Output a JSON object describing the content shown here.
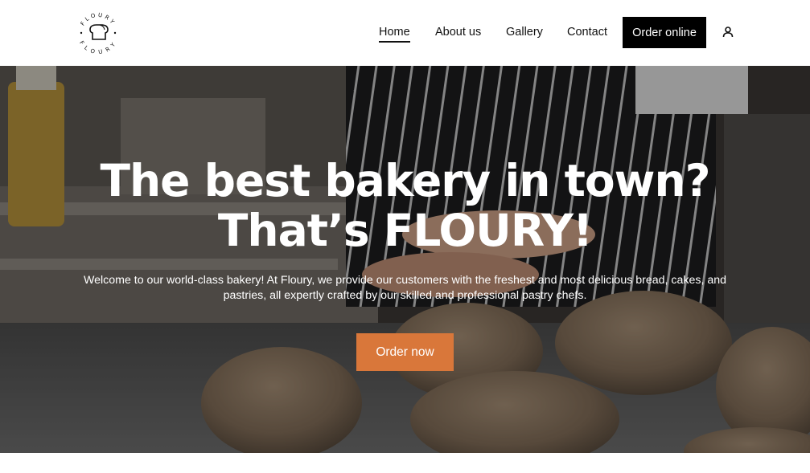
{
  "brand": {
    "logo_text": "FLOURY"
  },
  "nav": {
    "items": [
      {
        "label": "Home",
        "active": true
      },
      {
        "label": "About us",
        "active": false
      },
      {
        "label": "Gallery",
        "active": false
      },
      {
        "label": "Contact",
        "active": false
      }
    ],
    "cta_label": "Order online",
    "account_icon": "user-icon"
  },
  "hero": {
    "title_line1": "The best bakery in town?",
    "title_line2": "That’s FLOURY!",
    "description": "Welcome to our world-class bakery! At Floury, we provide our customers with the freshest and most delicious bread, cakes, and pastries, all expertly crafted by our skilled and professional pastry chefs.",
    "cta_label": "Order now"
  },
  "colors": {
    "accent": "#d9773a",
    "header_cta_bg": "#000000",
    "hero_text": "#ffffff"
  }
}
